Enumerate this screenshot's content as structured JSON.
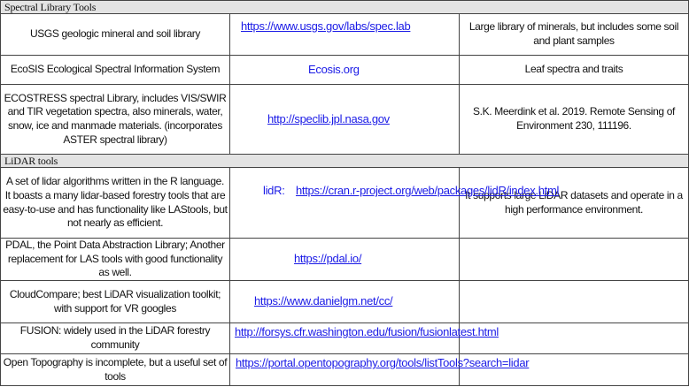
{
  "sections": [
    {
      "title": "Spectral Library Tools",
      "rows": [
        {
          "description": "USGS geologic mineral and soil library",
          "link": "https://www.usgs.gov/labs/spec.lab",
          "notes": "Large library of minerals, but includes some soil and plant samples"
        },
        {
          "description": "EcoSIS Ecological Spectral Information System",
          "link": "Ecosis.org",
          "notes": "Leaf spectra and traits"
        },
        {
          "description": "ECOSTRESS spectral Library, includes VIS/SWIR and TIR vegetation spectra, also minerals, water, snow, ice and manmade materials. (incorporates ASTER spectral library)",
          "link": "http://speclib.jpl.nasa.gov",
          "notes": "S.K. Meerdink et al.  2019. Remote Sensing of Environment 230, 111196."
        }
      ]
    },
    {
      "title": "LiDAR tools",
      "rows": [
        {
          "description": "A set of lidar algorithms written in the R language.  It boasts a many lidar-based forestry tools that are easy-to-use and has functionality like LAStools, but not nearly as efficient.",
          "link_prefix": "lidR: ",
          "link": "https://cran.r-project.org/web/packages/lidR/index.html",
          "notes": "It supports large LiDAR datasets and operate in a high performance environment."
        },
        {
          "description": "PDAL, the Point Data Abstraction Library; Another replacement for LAS tools with good functionality as well.",
          "link": "https://pdal.io/",
          "notes": ""
        },
        {
          "description": "CloudCompare; best LiDAR visualization toolkit; with support for VR googles",
          "link": "https://www.danielgm.net/cc/",
          "notes": ""
        },
        {
          "description": "FUSION: widely used in the LiDAR forestry community",
          "link": "http://forsys.cfr.washington.edu/fusion/fusionlatest.html",
          "notes": ""
        },
        {
          "description": "Open Topography is incomplete, but a useful set of tools",
          "link": "https://portal.opentopography.org/tools/listTools?search=lidar",
          "notes": ""
        }
      ]
    }
  ]
}
